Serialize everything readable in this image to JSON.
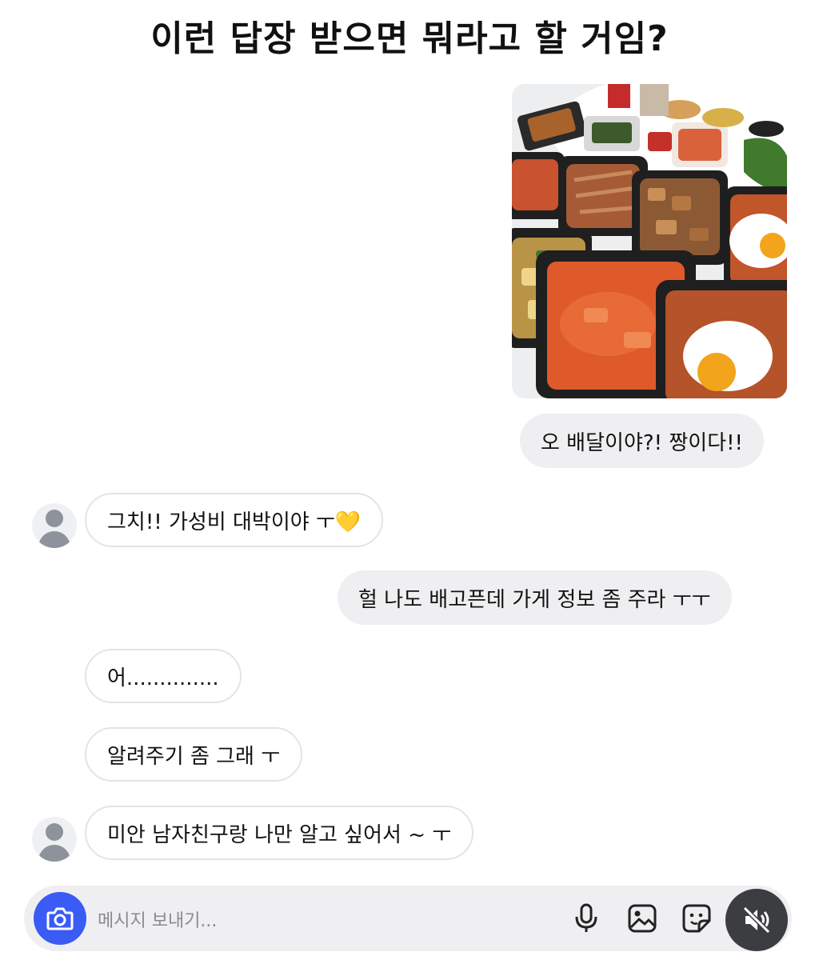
{
  "header": {
    "title": "이런 답장 받으면 뭐라고 할 거임?"
  },
  "messages": [
    {
      "from": "me",
      "text": "오 배달이야?! 짱이다!!"
    },
    {
      "from": "them",
      "text": "그치!! 가성비 대박이야 ㅜ💛"
    },
    {
      "from": "me",
      "text": "헐 나도 배고픈데 가게 정보 좀 주라 ㅜㅜ"
    },
    {
      "from": "them",
      "text": "어.............."
    },
    {
      "from": "them",
      "text": "알려주기 좀 그래 ㅜ"
    },
    {
      "from": "them",
      "text": "미안 남자친구랑 나만 알고 싶어서 ~ ㅜ"
    }
  ],
  "composer": {
    "placeholder": "메시지 보내기...",
    "icons": [
      "camera-icon",
      "microphone-icon",
      "gallery-icon",
      "sticker-icon",
      "muted-speaker-icon"
    ]
  },
  "colors": {
    "camera_button": "#3b5bf5",
    "sent_bubble": "#efeff1",
    "received_border": "#e4e4e7",
    "mute_button": "#3c3d41"
  }
}
